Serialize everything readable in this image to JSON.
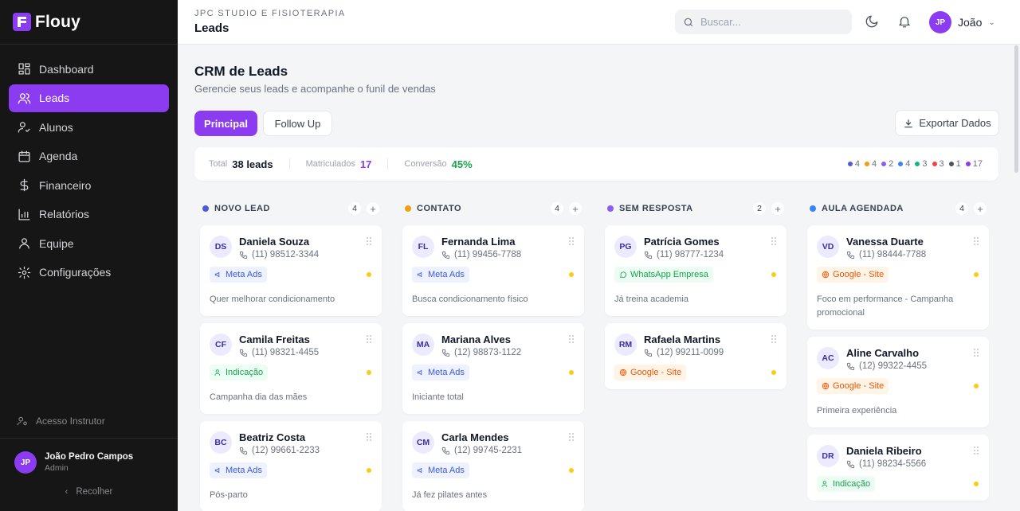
{
  "brand": {
    "name": "Flouy"
  },
  "sidebar": {
    "items": [
      {
        "label": "Dashboard",
        "icon": "grid-icon",
        "active": false
      },
      {
        "label": "Leads",
        "icon": "users-icon",
        "active": true
      },
      {
        "label": "Alunos",
        "icon": "user-check-icon",
        "active": false
      },
      {
        "label": "Agenda",
        "icon": "calendar-icon",
        "active": false
      },
      {
        "label": "Financeiro",
        "icon": "dollar-icon",
        "active": false
      },
      {
        "label": "Relatórios",
        "icon": "bar-chart-icon",
        "active": false
      },
      {
        "label": "Equipe",
        "icon": "user-icon",
        "active": false
      },
      {
        "label": "Configurações",
        "icon": "gear-icon",
        "active": false
      }
    ],
    "instructor_label": "Acesso Instrutor",
    "user": {
      "initials": "JP",
      "name": "João Pedro Campos",
      "role": "Admin"
    },
    "collapse_label": "Recolher"
  },
  "header": {
    "studio": "JPC STUDIO E FISIOTERAPIA",
    "title": "Leads",
    "search_placeholder": "Buscar...",
    "user_initials": "JP",
    "user_name": "João"
  },
  "main": {
    "title": "CRM de Leads",
    "subtitle": "Gerencie seus leads e acompanhe o funil de vendas",
    "tabs": [
      {
        "label": "Principal",
        "active": true
      },
      {
        "label": "Follow Up",
        "active": false
      }
    ],
    "export_label": "Exportar Dados"
  },
  "stats": {
    "total_label": "Total",
    "total_value": "38 leads",
    "enrolled_label": "Matriculados",
    "enrolled_value": "17",
    "conversion_label": "Conversão",
    "conversion_value": "45%",
    "dots": [
      {
        "color": "#4f5bd5",
        "count": "4"
      },
      {
        "color": "#f59e0b",
        "count": "4"
      },
      {
        "color": "#8b5cf6",
        "count": "2"
      },
      {
        "color": "#3b82f6",
        "count": "4"
      },
      {
        "color": "#10b981",
        "count": "3"
      },
      {
        "color": "#ef4444",
        "count": "3"
      },
      {
        "color": "#4b5563",
        "count": "1"
      },
      {
        "color": "#8b3cf0",
        "count": "17"
      }
    ]
  },
  "columns": [
    {
      "title": "NOVO LEAD",
      "color": "#4f5bd5",
      "count": "4",
      "cards": [
        {
          "initials": "DS",
          "name": "Daniela Souza",
          "phone": "(11) 98512-3344",
          "source": "Meta Ads",
          "type": "meta",
          "note": "Quer melhorar condicionamento"
        },
        {
          "initials": "CF",
          "name": "Camila Freitas",
          "phone": "(11) 98321-4455",
          "source": "Indicação",
          "type": "ind",
          "note": "Campanha dia das mães"
        },
        {
          "initials": "BC",
          "name": "Beatriz Costa",
          "phone": "(12) 99661-2233",
          "source": "Meta Ads",
          "type": "meta",
          "note": "Pós-parto"
        }
      ]
    },
    {
      "title": "CONTATO",
      "color": "#f59e0b",
      "count": "4",
      "cards": [
        {
          "initials": "FL",
          "name": "Fernanda Lima",
          "phone": "(11) 99456-7788",
          "source": "Meta Ads",
          "type": "meta",
          "note": "Busca condicionamento físico"
        },
        {
          "initials": "MA",
          "name": "Mariana Alves",
          "phone": "(12) 98873-1122",
          "source": "Meta Ads",
          "type": "meta",
          "note": "Iniciante total"
        },
        {
          "initials": "CM",
          "name": "Carla Mendes",
          "phone": "(12) 99745-2231",
          "source": "Meta Ads",
          "type": "meta",
          "note": "Já fez pilates antes"
        }
      ]
    },
    {
      "title": "SEM RESPOSTA",
      "color": "#8b5cf6",
      "count": "2",
      "cards": [
        {
          "initials": "PG",
          "name": "Patrícia Gomes",
          "phone": "(11) 98777-1234",
          "source": "WhatsApp Empresa",
          "type": "whats",
          "note": "Já treina academia"
        },
        {
          "initials": "RM",
          "name": "Rafaela Martins",
          "phone": "(12) 99211-0099",
          "source": "Google - Site",
          "type": "google",
          "note": ""
        }
      ]
    },
    {
      "title": "AULA AGENDADA",
      "color": "#3b82f6",
      "count": "4",
      "cards": [
        {
          "initials": "VD",
          "name": "Vanessa Duarte",
          "phone": "(11) 98444-7788",
          "source": "Google - Site",
          "type": "google",
          "note": "Foco em performance - Campanha promocional"
        },
        {
          "initials": "AC",
          "name": "Aline Carvalho",
          "phone": "(12) 99322-4455",
          "source": "Google - Site",
          "type": "google",
          "note": "Primeira experiência"
        },
        {
          "initials": "DR",
          "name": "Daniela Ribeiro",
          "phone": "(11) 98234-5566",
          "source": "Indicação",
          "type": "ind",
          "note": ""
        }
      ]
    }
  ]
}
